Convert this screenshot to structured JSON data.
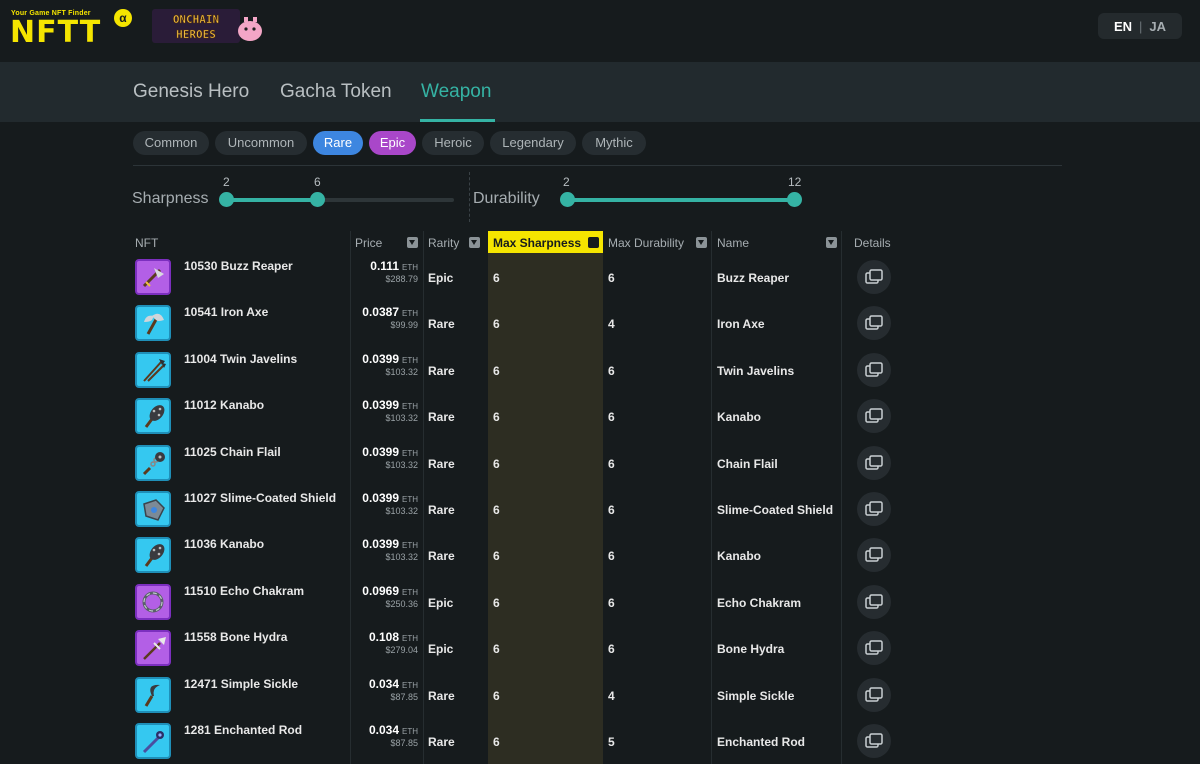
{
  "header": {
    "logo_tagline": "Your Game NFT Finder",
    "logo_text": "NFTT",
    "logo_badge": "α",
    "game_logo_text": "ONCHAIN HEROES",
    "lang_en": "EN",
    "lang_sep": "|",
    "lang_ja": "JA"
  },
  "tabs": [
    {
      "label": "Genesis Hero",
      "active": false
    },
    {
      "label": "Gacha Token",
      "active": false
    },
    {
      "label": "Weapon",
      "active": true
    }
  ],
  "rarity_chips": [
    {
      "label": "Common",
      "selected": false
    },
    {
      "label": "Uncommon",
      "selected": false
    },
    {
      "label": "Rare",
      "selected": true
    },
    {
      "label": "Epic",
      "selected": true
    },
    {
      "label": "Heroic",
      "selected": false
    },
    {
      "label": "Legendary",
      "selected": false
    },
    {
      "label": "Mythic",
      "selected": false
    }
  ],
  "sliders": {
    "sharpness": {
      "label": "Sharpness",
      "min_val": "2",
      "max_val": "6"
    },
    "durability": {
      "label": "Durability",
      "min_val": "2",
      "max_val": "12"
    }
  },
  "table": {
    "headers": {
      "nft": "NFT",
      "price": "Price",
      "rarity": "Rarity",
      "max_sharpness": "Max Sharpness",
      "max_durability": "Max Durability",
      "name": "Name",
      "details": "Details"
    },
    "eth_unit": "ETH",
    "rows": [
      {
        "title": "10530 Buzz Reaper",
        "eth": "0.111",
        "usd": "$288.79",
        "rarity": "Epic",
        "sharp": "6",
        "dur": "6",
        "name": "Buzz Reaper",
        "icon": "reaper-icon"
      },
      {
        "title": "10541 Iron Axe",
        "eth": "0.0387",
        "usd": "$99.99",
        "rarity": "Rare",
        "sharp": "6",
        "dur": "4",
        "name": "Iron Axe",
        "icon": "axe-icon"
      },
      {
        "title": "11004 Twin Javelins",
        "eth": "0.0399",
        "usd": "$103.32",
        "rarity": "Rare",
        "sharp": "6",
        "dur": "6",
        "name": "Twin Javelins",
        "icon": "javelin-icon"
      },
      {
        "title": "11012 Kanabo",
        "eth": "0.0399",
        "usd": "$103.32",
        "rarity": "Rare",
        "sharp": "6",
        "dur": "6",
        "name": "Kanabo",
        "icon": "club-icon"
      },
      {
        "title": "11025 Chain Flail",
        "eth": "0.0399",
        "usd": "$103.32",
        "rarity": "Rare",
        "sharp": "6",
        "dur": "6",
        "name": "Chain Flail",
        "icon": "flail-icon"
      },
      {
        "title": "11027 Slime-Coated Shield",
        "eth": "0.0399",
        "usd": "$103.32",
        "rarity": "Rare",
        "sharp": "6",
        "dur": "6",
        "name": "Slime-Coated Shield",
        "icon": "shield-icon"
      },
      {
        "title": "11036 Kanabo",
        "eth": "0.0399",
        "usd": "$103.32",
        "rarity": "Rare",
        "sharp": "6",
        "dur": "6",
        "name": "Kanabo",
        "icon": "club-icon"
      },
      {
        "title": "11510 Echo Chakram",
        "eth": "0.0969",
        "usd": "$250.36",
        "rarity": "Epic",
        "sharp": "6",
        "dur": "6",
        "name": "Echo Chakram",
        "icon": "chakram-icon"
      },
      {
        "title": "11558 Bone Hydra",
        "eth": "0.108",
        "usd": "$279.04",
        "rarity": "Epic",
        "sharp": "6",
        "dur": "6",
        "name": "Bone Hydra",
        "icon": "spear-icon"
      },
      {
        "title": "12471 Simple Sickle",
        "eth": "0.034",
        "usd": "$87.85",
        "rarity": "Rare",
        "sharp": "6",
        "dur": "4",
        "name": "Simple Sickle",
        "icon": "sickle-icon"
      },
      {
        "title": "1281 Enchanted Rod",
        "eth": "0.034",
        "usd": "$87.85",
        "rarity": "Rare",
        "sharp": "6",
        "dur": "5",
        "name": "Enchanted Rod",
        "icon": "rod-icon"
      }
    ]
  },
  "colors": {
    "accent": "#35b3a4",
    "highlight": "#f5e500",
    "rare": "#3d86e0",
    "epic": "#a947c9"
  }
}
